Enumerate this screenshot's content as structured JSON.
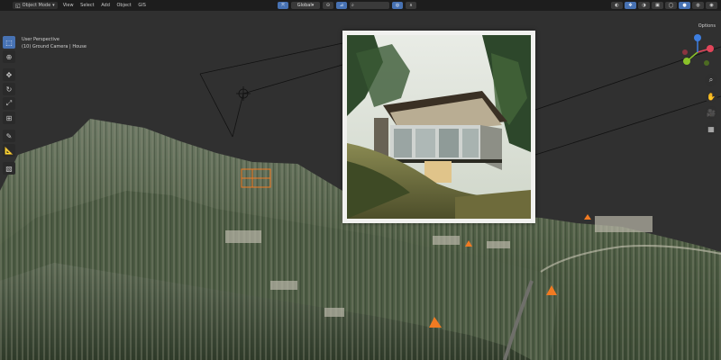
{
  "header": {
    "mode_label": "Object Mode",
    "menu": [
      "View",
      "Select",
      "Add",
      "Object",
      "GIS"
    ],
    "transform_orientation": "Global",
    "right_tab": "Options"
  },
  "viewport": {
    "title": "User Perspective",
    "collection": "(10) Ground Camera | House"
  },
  "toolbar": {
    "tools": [
      "select-box",
      "cursor",
      "move",
      "rotate",
      "scale",
      "transform",
      "annotate",
      "measure",
      "add-cube"
    ]
  },
  "colors": {
    "header_bg": "#1d1d1d",
    "viewport_bg": "#303030",
    "active_blue": "#4772b3",
    "gizmo_x": "#e2455a",
    "gizmo_y": "#8ac229",
    "gizmo_z": "#3d7ee0",
    "selection_orange": "#f07a22"
  }
}
